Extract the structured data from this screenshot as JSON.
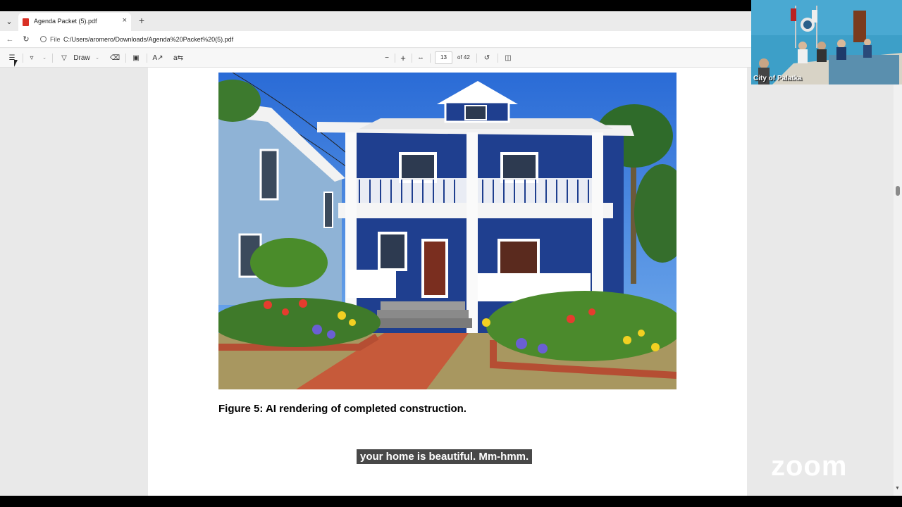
{
  "browser": {
    "tab_title": "Agenda Packet (5).pdf",
    "tab_close": "×",
    "new_tab": "+",
    "tab_menu": "⌄",
    "file_label": "File",
    "url": "C:/Users/aromero/Downloads/Agenda%20Packet%20(5).pdf"
  },
  "pdf_toolbar": {
    "draw_label": "Draw",
    "current_page": "13",
    "total_pages": "of 42",
    "zoom_out": "−",
    "zoom_in": "+"
  },
  "document": {
    "caption": "Figure 5: AI rendering of completed construction."
  },
  "subtitle": "your home is beautiful. Mm-hmm.",
  "zoom": {
    "video_label": "City of Palatka",
    "logo": "zoom"
  },
  "colors": {
    "house_blue": "#1f3f8f",
    "sky": "#2f74d8",
    "trim": "#ffffff",
    "brick": "#c65a3a"
  }
}
